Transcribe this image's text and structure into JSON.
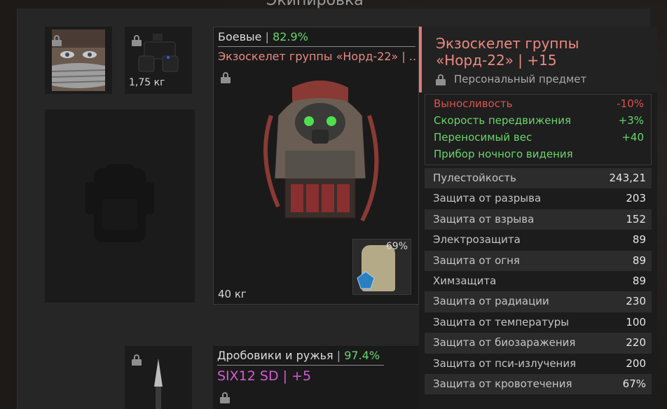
{
  "header": {
    "title": "Экипировка"
  },
  "slots": {
    "mask_weight": "",
    "nightvision_weight": "1,75 кг"
  },
  "armor_card": {
    "category": "Боевые",
    "category_pct": "82.9%",
    "item_name": "Экзоскелет группы «Норд-22» | ..",
    "weight": "40 кг",
    "plate_durability": "69%"
  },
  "tooltip": {
    "title_line1": "Экзоскелет группы",
    "title_line2": "«Норд-22» | +15",
    "personal": "Персональный предмет",
    "effects": [
      {
        "label": "Выносливость",
        "value": "-10%",
        "color": "#d9534f"
      },
      {
        "label": "Скорость передвижения",
        "value": "+3%",
        "color": "#6bd46b"
      },
      {
        "label": "Переносимый вес",
        "value": "+40",
        "color": "#6bd46b"
      },
      {
        "label": "Прибор ночного видения",
        "value": "",
        "color": "#6bd46b"
      }
    ],
    "stats": [
      {
        "label": "Пулестойкость",
        "value": "243,21"
      },
      {
        "label": "Защита от разрыва",
        "value": "203"
      },
      {
        "label": "Защита от взрыва",
        "value": "152"
      },
      {
        "label": "Электрозащита",
        "value": "89"
      },
      {
        "label": "Защита от огня",
        "value": "89"
      },
      {
        "label": "Химзащита",
        "value": "89"
      },
      {
        "label": "Защита от радиации",
        "value": "230"
      },
      {
        "label": "Защита от температуры",
        "value": "100"
      },
      {
        "label": "Защита от биозаражения",
        "value": "220"
      },
      {
        "label": "Защита от пси-излучения",
        "value": "200"
      },
      {
        "label": "Защита от кровотечения",
        "value": "67%"
      }
    ]
  },
  "weapon_card": {
    "category": "Дробовики и ружья",
    "category_pct": "97.4%",
    "item_name": "SIX12 SD",
    "upgrade": "+5"
  },
  "colors": {
    "accent_red": "#ec8a80",
    "accent_green": "#6bd46b",
    "accent_purple": "#d45bd4"
  }
}
